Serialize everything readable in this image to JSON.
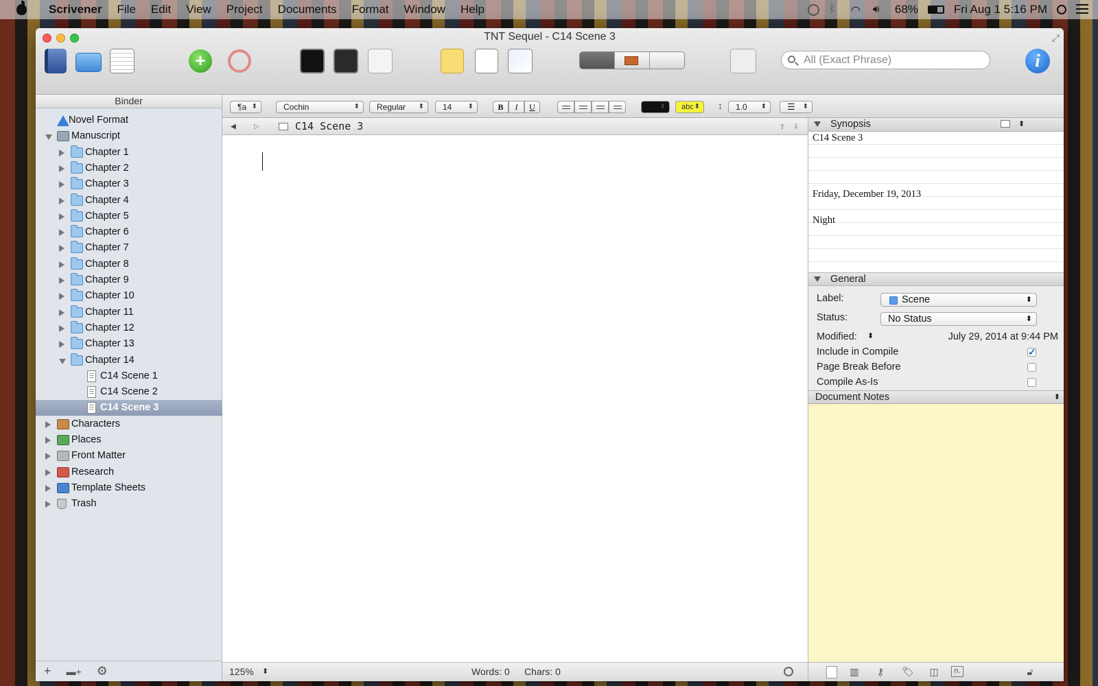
{
  "menubar": {
    "app": "Scrivener",
    "items": [
      "File",
      "Edit",
      "View",
      "Project",
      "Documents",
      "Format",
      "Window",
      "Help"
    ],
    "battery": "68%",
    "clock": "Fri Aug 1  5:16 PM"
  },
  "window": {
    "title": "TNT Sequel - C14 Scene 3",
    "search_placeholder": "All (Exact Phrase)"
  },
  "binder": {
    "header": "Binder",
    "items": [
      {
        "label": "Novel Format",
        "icon": "info-icon"
      },
      {
        "label": "Manuscript",
        "icon": "manuscript-icon"
      },
      {
        "label": "Chapter 1"
      },
      {
        "label": "Chapter 2"
      },
      {
        "label": "Chapter 3"
      },
      {
        "label": "Chapter 4"
      },
      {
        "label": "Chapter 5"
      },
      {
        "label": "Chapter 6"
      },
      {
        "label": "Chapter 7"
      },
      {
        "label": "Chapter 8"
      },
      {
        "label": "Chapter 9"
      },
      {
        "label": "Chapter 10"
      },
      {
        "label": "Chapter 11"
      },
      {
        "label": "Chapter 12"
      },
      {
        "label": "Chapter 13"
      },
      {
        "label": "Chapter 14"
      },
      {
        "label": "C14 Scene 1"
      },
      {
        "label": "C14 Scene 2"
      },
      {
        "label": "C14 Scene 3"
      },
      {
        "label": "Characters"
      },
      {
        "label": "Places"
      },
      {
        "label": "Front Matter"
      },
      {
        "label": "Research"
      },
      {
        "label": "Template Sheets"
      },
      {
        "label": "Trash"
      }
    ]
  },
  "format_bar": {
    "paragraph_style": "¶a",
    "font": "Cochin",
    "weight": "Regular",
    "size": "14",
    "bold": "B",
    "italic": "I",
    "underline": "U",
    "highlight": "abc",
    "line_spacing": "1.0"
  },
  "editor": {
    "header_title": "C14 Scene 3",
    "zoom": "125%",
    "words": "Words: 0",
    "chars": "Chars: 0"
  },
  "inspector": {
    "synopsis_header": "Synopsis",
    "synopsis_lines": [
      "C14 Scene 3",
      "Friday, December 19, 2013",
      "Night"
    ],
    "general_header": "General",
    "label_caption": "Label:",
    "label_value": "Scene",
    "status_caption": "Status:",
    "status_value": "No Status",
    "modified_caption": "Modified:",
    "modified_value": "July 29, 2014 at 9:44 PM",
    "include_compile": "Include in Compile",
    "page_break": "Page Break Before",
    "compile_as_is": "Compile As-Is",
    "notes_header": "Document Notes"
  },
  "colors": {
    "label_scene": "#5b9be8",
    "notes_bg": "#fdf6c7",
    "selection": "#8d9ab3"
  }
}
